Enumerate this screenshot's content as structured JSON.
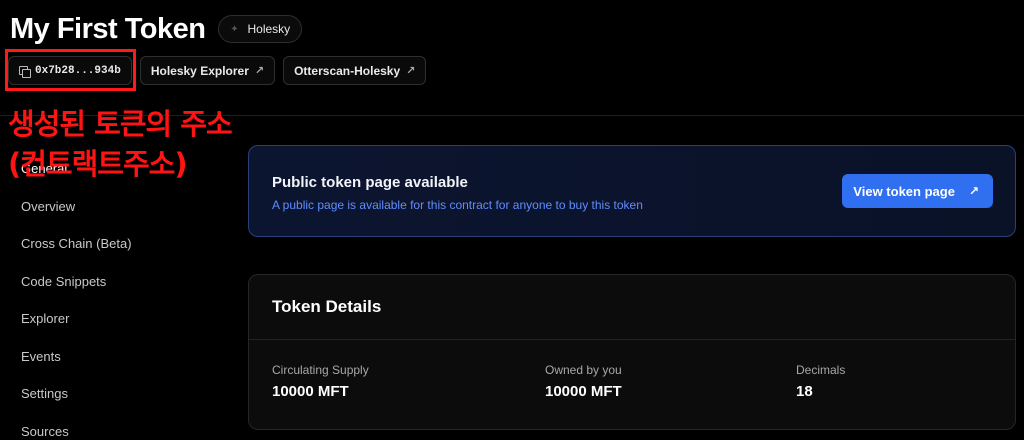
{
  "header": {
    "title": "My First Token",
    "network": "Holesky",
    "network_icon": "star-icon"
  },
  "links": {
    "address": "0x7b28...934b",
    "explorer": "Holesky Explorer",
    "otterscan": "Otterscan-Holesky"
  },
  "annotation": {
    "line1": "생성된 토큰의 주소",
    "line2": "(컨트랙트주소)",
    "color": "#ff1414"
  },
  "sidebar": {
    "items": [
      {
        "label": "General"
      },
      {
        "label": "Overview"
      },
      {
        "label": "Cross Chain (Beta)"
      },
      {
        "label": "Code Snippets"
      },
      {
        "label": "Explorer"
      },
      {
        "label": "Events"
      },
      {
        "label": "Settings"
      },
      {
        "label": "Sources"
      }
    ]
  },
  "banner": {
    "title": "Public token page available",
    "description": "A public page is available for this contract for anyone to buy this token",
    "button": "View token page",
    "accent": "#2f6ff0"
  },
  "token_details": {
    "title": "Token Details",
    "stats": [
      {
        "label": "Circulating Supply",
        "value": "10000 MFT"
      },
      {
        "label": "Owned by you",
        "value": "10000 MFT"
      },
      {
        "label": "Decimals",
        "value": "18"
      }
    ]
  }
}
